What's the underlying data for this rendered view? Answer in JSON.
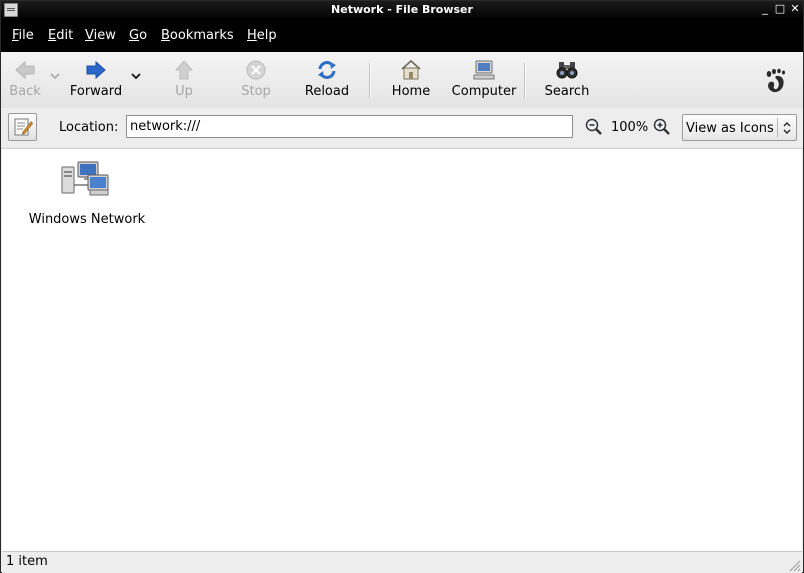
{
  "window": {
    "title": "Network - File Browser"
  },
  "menu": [
    {
      "first": "F",
      "rest": "ile"
    },
    {
      "first": "E",
      "rest": "dit"
    },
    {
      "first": "V",
      "rest": "iew"
    },
    {
      "first": "G",
      "rest": "o"
    },
    {
      "first": "B",
      "rest": "ookmarks"
    },
    {
      "first": "H",
      "rest": "elp"
    }
  ],
  "toolbar": {
    "back": "Back",
    "forward": "Forward",
    "up": "Up",
    "stop": "Stop",
    "reload": "Reload",
    "home": "Home",
    "computer": "Computer",
    "search": "Search"
  },
  "location": {
    "label": "Location:",
    "value": "network:///",
    "zoom": "100%",
    "view_mode": "View as Icons"
  },
  "items": [
    {
      "name": "Windows Network",
      "icon": "network-computers-icon"
    }
  ],
  "status": {
    "text": "1 item"
  },
  "colors": {
    "titlebar": "#000000",
    "menubar": "#000000",
    "reload_blue": "#2d6fc4",
    "forward_blue": "#2a67c9"
  }
}
